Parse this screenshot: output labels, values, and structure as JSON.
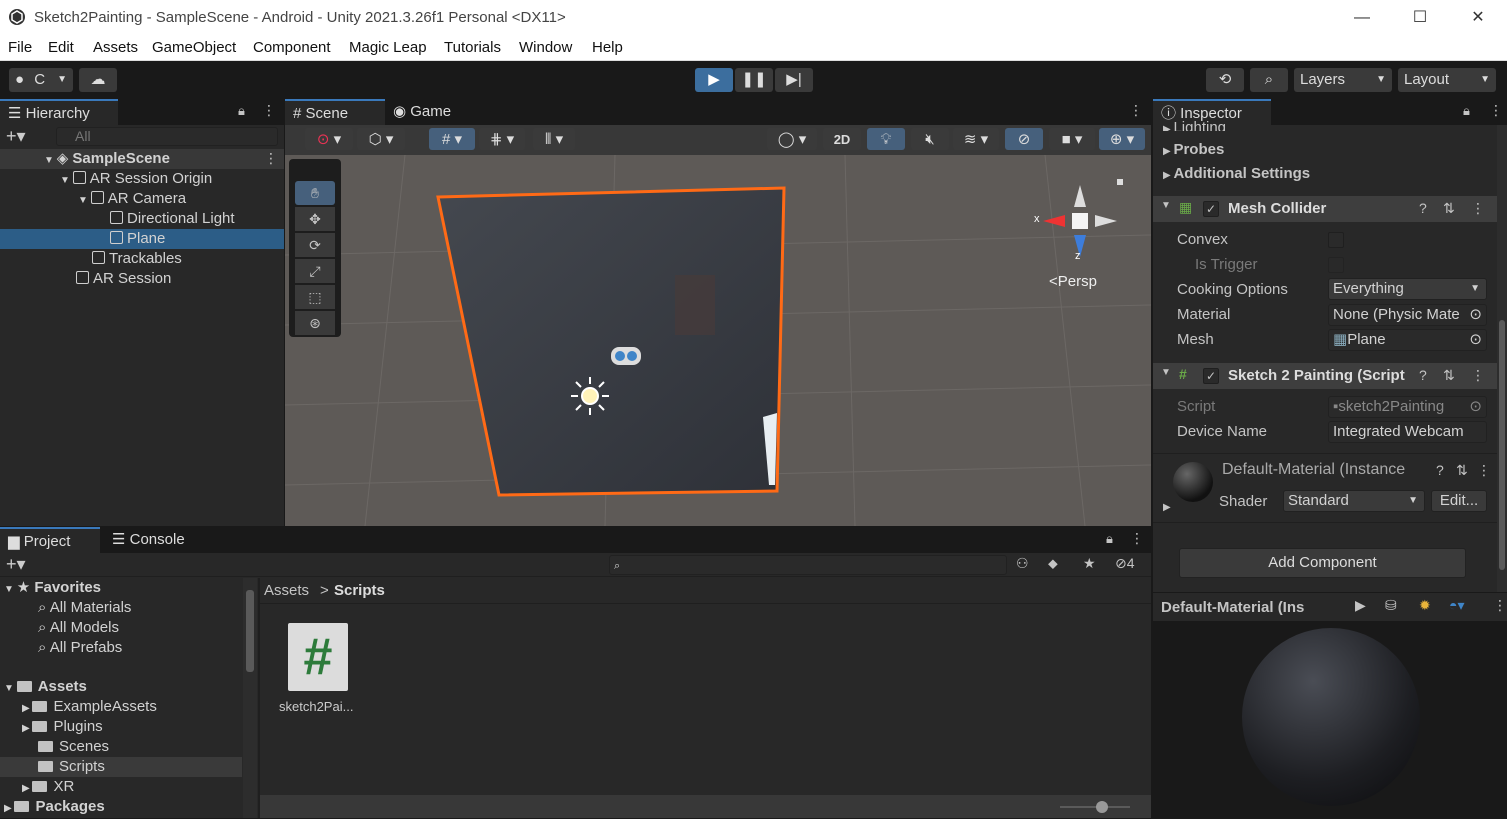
{
  "window": {
    "title": "Sketch2Painting - SampleScene - Android - Unity 2021.3.26f1 Personal <DX11>",
    "minimize": "—",
    "maximize": "☐",
    "close": "✕"
  },
  "menu": [
    "File",
    "Edit",
    "Assets",
    "GameObject",
    "Component",
    "Magic Leap",
    "Tutorials",
    "Window",
    "Help"
  ],
  "toolbar": {
    "account_label": "C",
    "layers_label": "Layers",
    "layout_label": "Layout"
  },
  "hierarchy": {
    "tab": "Hierarchy",
    "search_placeholder": "All",
    "scene": "SampleScene",
    "items": [
      "AR Session Origin",
      "AR Camera",
      "Directional Light",
      "Plane",
      "Trackables",
      "AR Session"
    ]
  },
  "scene_view": {
    "tabs": [
      "Scene",
      "Game"
    ],
    "btn_2d": "2D",
    "persp_label": "<Persp",
    "gizmo_x": "x",
    "gizmo_z": "z"
  },
  "inspector": {
    "tab": "Inspector",
    "sections": [
      "Lighting",
      "Probes",
      "Additional Settings"
    ],
    "mesh_collider": {
      "title": "Mesh Collider",
      "convex_label": "Convex",
      "is_trigger_label": "Is Trigger",
      "cooking_label": "Cooking Options",
      "cooking_value": "Everything",
      "material_label": "Material",
      "material_value": "None (Physic Mate",
      "mesh_label": "Mesh",
      "mesh_value": "Plane"
    },
    "script_comp": {
      "title": "Sketch 2 Painting (Script",
      "script_label": "Script",
      "script_value": "sketch2Painting",
      "device_label": "Device Name",
      "device_value": "Integrated Webcam"
    },
    "material": {
      "title": "Default-Material (Instance",
      "shader_label": "Shader",
      "shader_value": "Standard",
      "edit_label": "Edit..."
    },
    "add_component": "Add Component",
    "preview_title": "Default-Material (Ins"
  },
  "project": {
    "tabs": [
      "Project",
      "Console"
    ],
    "favorites_label": "Favorites",
    "favorites": [
      "All Materials",
      "All Models",
      "All Prefabs"
    ],
    "assets_label": "Assets",
    "assets_children": [
      "ExampleAssets",
      "Plugins",
      "Scenes",
      "Scripts",
      "XR"
    ],
    "packages_label": "Packages",
    "breadcrumb_root": "Assets",
    "breadcrumb_sep": ">",
    "breadcrumb_current": "Scripts",
    "file_name": "sketch2Pai...",
    "hidden_count": "4"
  }
}
